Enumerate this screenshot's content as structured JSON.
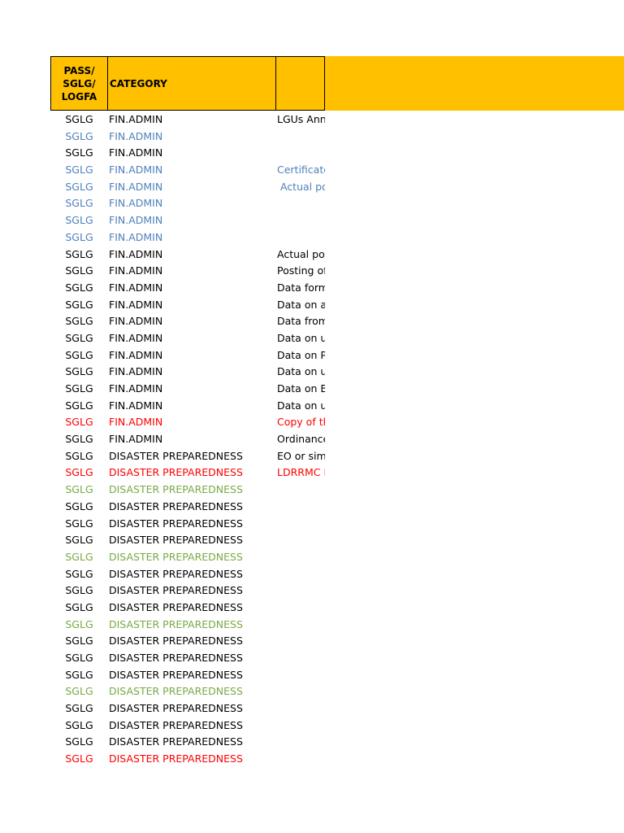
{
  "header": {
    "pass_label": "PASS/\nSGLG/\nLOGFA",
    "category_label": "CATEGORY",
    "description_label": ""
  },
  "colors": {
    "header_fill": "#ffc000",
    "black": "#000000",
    "blue": "#4f81bd",
    "red": "#ff0000",
    "green": "#77aa44"
  },
  "rows": [
    {
      "pass": "SGLG",
      "category": "FIN.ADMIN",
      "description": "LGUs Ann",
      "color": "black"
    },
    {
      "pass": "SGLG",
      "category": "FIN.ADMIN",
      "description": "",
      "color": "blue"
    },
    {
      "pass": "SGLG",
      "category": "FIN.ADMIN",
      "description": "",
      "color": "black"
    },
    {
      "pass": "SGLG",
      "category": "FIN.ADMIN",
      "description": "Certificate",
      "color": "blue"
    },
    {
      "pass": "SGLG",
      "category": "FIN.ADMIN",
      "description": " Actual po",
      "color": "blue"
    },
    {
      "pass": "SGLG",
      "category": "FIN.ADMIN",
      "description": "",
      "color": "blue"
    },
    {
      "pass": "SGLG",
      "category": "FIN.ADMIN",
      "description": "",
      "color": "blue"
    },
    {
      "pass": "SGLG",
      "category": "FIN.ADMIN",
      "description": "",
      "color": "blue"
    },
    {
      "pass": "SGLG",
      "category": "FIN.ADMIN",
      "description": "Actual pos",
      "color": "black"
    },
    {
      "pass": "SGLG",
      "category": "FIN.ADMIN",
      "description": "Posting of",
      "color": "black"
    },
    {
      "pass": "SGLG",
      "category": "FIN.ADMIN",
      "description": "Data form",
      "color": "black"
    },
    {
      "pass": "SGLG",
      "category": "FIN.ADMIN",
      "description": "Data on a",
      "color": "black"
    },
    {
      "pass": "SGLG",
      "category": "FIN.ADMIN",
      "description": "Data from",
      "color": "black"
    },
    {
      "pass": "SGLG",
      "category": "FIN.ADMIN",
      "description": "Data on u",
      "color": "black"
    },
    {
      "pass": "SGLG",
      "category": "FIN.ADMIN",
      "description": "Data on P",
      "color": "black"
    },
    {
      "pass": "SGLG",
      "category": "FIN.ADMIN",
      "description": "Data on u",
      "color": "black"
    },
    {
      "pass": "SGLG",
      "category": "FIN.ADMIN",
      "description": "Data on B",
      "color": "black"
    },
    {
      "pass": "SGLG",
      "category": "FIN.ADMIN",
      "description": "Data on u",
      "color": "black"
    },
    {
      "pass": "SGLG",
      "category": "FIN.ADMIN",
      "description": "Copy of th",
      "color": "red"
    },
    {
      "pass": "SGLG",
      "category": "FIN.ADMIN",
      "description": "Ordinance",
      "color": "black"
    },
    {
      "pass": "SGLG",
      "category": "DISASTER PREPAREDNESS",
      "description": "EO or sim",
      "color": "black"
    },
    {
      "pass": "SGLG",
      "category": "DISASTER PREPAREDNESS",
      "description": "LDRRMC M",
      "color": "red"
    },
    {
      "pass": "SGLG",
      "category": "DISASTER PREPAREDNESS",
      "description": "",
      "color": "green"
    },
    {
      "pass": "SGLG",
      "category": "DISASTER PREPAREDNESS",
      "description": "",
      "color": "black"
    },
    {
      "pass": "SGLG",
      "category": "DISASTER PREPAREDNESS",
      "description": "",
      "color": "black"
    },
    {
      "pass": "SGLG",
      "category": "DISASTER PREPAREDNESS",
      "description": "",
      "color": "black"
    },
    {
      "pass": "SGLG",
      "category": "DISASTER PREPAREDNESS",
      "description": "",
      "color": "green"
    },
    {
      "pass": "SGLG",
      "category": "DISASTER PREPAREDNESS",
      "description": "",
      "color": "black"
    },
    {
      "pass": "SGLG",
      "category": "DISASTER PREPAREDNESS",
      "description": "",
      "color": "black"
    },
    {
      "pass": "SGLG",
      "category": "DISASTER PREPAREDNESS",
      "description": "",
      "color": "black"
    },
    {
      "pass": "SGLG",
      "category": "DISASTER PREPAREDNESS",
      "description": "",
      "color": "green"
    },
    {
      "pass": "SGLG",
      "category": "DISASTER PREPAREDNESS",
      "description": "",
      "color": "black"
    },
    {
      "pass": "SGLG",
      "category": "DISASTER PREPAREDNESS",
      "description": "",
      "color": "black"
    },
    {
      "pass": "SGLG",
      "category": "DISASTER PREPAREDNESS",
      "description": "",
      "color": "black"
    },
    {
      "pass": "SGLG",
      "category": "DISASTER PREPAREDNESS",
      "description": "",
      "color": "green"
    },
    {
      "pass": "SGLG",
      "category": "DISASTER PREPAREDNESS",
      "description": "",
      "color": "black"
    },
    {
      "pass": "SGLG",
      "category": "DISASTER PREPAREDNESS",
      "description": "",
      "color": "black"
    },
    {
      "pass": "SGLG",
      "category": "DISASTER PREPAREDNESS",
      "description": "",
      "color": "black"
    },
    {
      "pass": "SGLG",
      "category": "DISASTER PREPAREDNESS",
      "description": "",
      "color": "red"
    }
  ]
}
